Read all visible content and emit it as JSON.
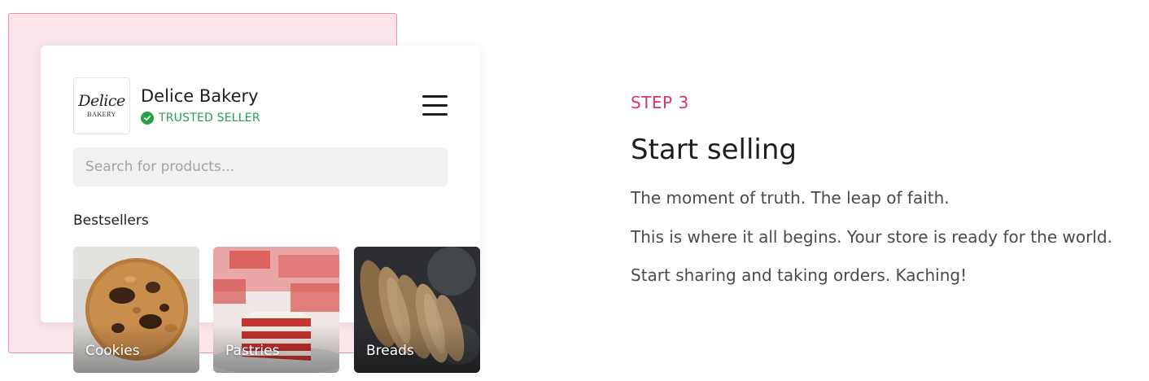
{
  "store": {
    "logo_script": "Delice",
    "logo_sub": "BAKERY",
    "name": "Delice Bakery",
    "badge": "TRUSTED SELLER",
    "search_placeholder": "Search for products...",
    "section_title": "Bestsellers",
    "categories": [
      {
        "label": "Cookies"
      },
      {
        "label": "Pastries"
      },
      {
        "label": "Breads"
      }
    ]
  },
  "step": {
    "label": "STEP 3",
    "heading": "Start selling",
    "paragraphs": [
      "The moment of truth. The leap of faith.",
      "This is where it all begins. Your store is ready for the world.",
      "Start sharing and taking orders. Kaching!"
    ]
  },
  "colors": {
    "accent": "#d6336c",
    "trusted_green": "#25a244",
    "panel_pink": "#fbe4ea"
  }
}
